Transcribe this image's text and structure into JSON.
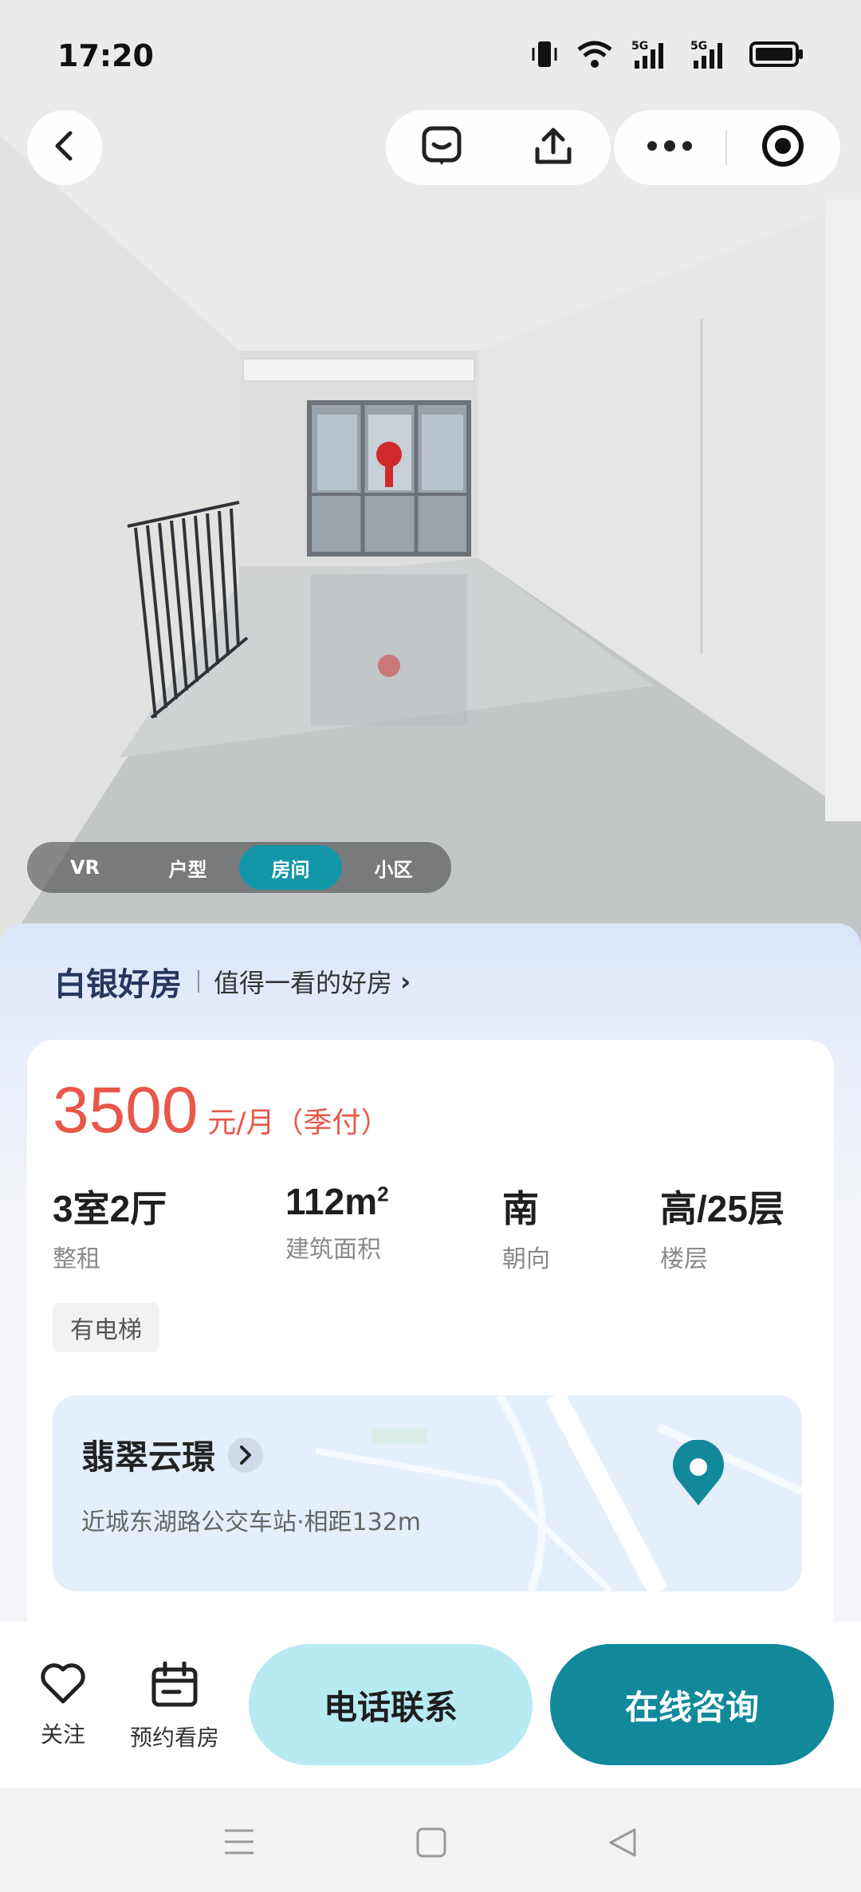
{
  "status_bar": {
    "time": "17:20"
  },
  "icons": {
    "back": "chevron-left-icon",
    "chat": "message-icon",
    "share": "share-icon",
    "more": "more-icon",
    "record": "target-icon"
  },
  "media_tabs": [
    {
      "label": "VR",
      "active": false
    },
    {
      "label": "户型",
      "active": false
    },
    {
      "label": "房间",
      "active": true
    },
    {
      "label": "小区",
      "active": false
    }
  ],
  "promo": {
    "brand": "白银好房",
    "subtitle": "值得一看的好房",
    "chevron": "›"
  },
  "listing": {
    "price": "3500",
    "price_unit": "元/月（季付）",
    "stats": [
      {
        "value": "3室2厅",
        "label": "整租"
      },
      {
        "value": "112m",
        "sup": "2",
        "label": "建筑面积"
      },
      {
        "value": "南",
        "label": "朝向"
      },
      {
        "value": "高/25层",
        "label": "楼层"
      }
    ],
    "tags": [
      "有电梯"
    ]
  },
  "location": {
    "community": "翡翠云璟",
    "nearby": "近城东湖路公交车站·相距132m"
  },
  "bottom_bar": {
    "follow_label": "关注",
    "schedule_label": "预约看房",
    "call_label": "电话联系",
    "chat_label": "在线咨询"
  },
  "colors": {
    "accent": "#11899b",
    "price": "#e8574a",
    "call_button": "#b8eaf2",
    "brand_text": "#25375d"
  }
}
